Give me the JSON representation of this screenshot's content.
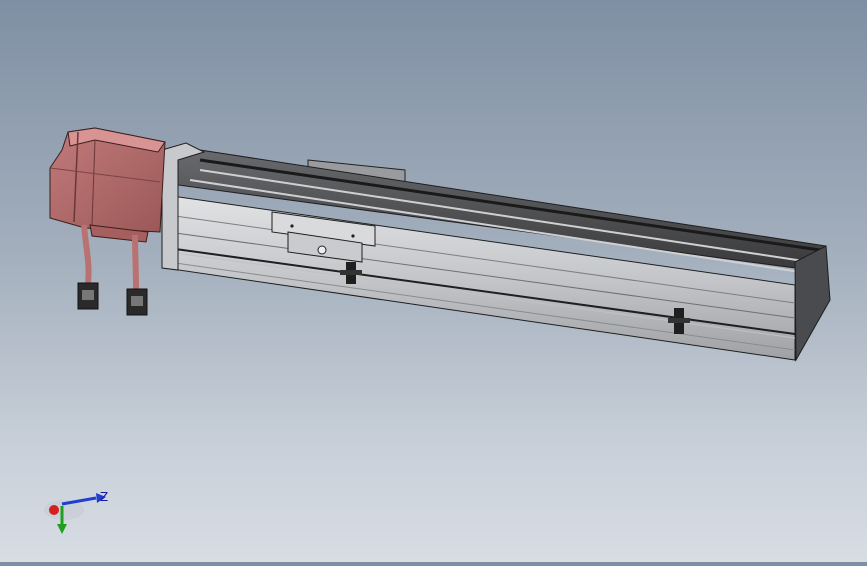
{
  "viewport": {
    "model": "linear-actuator-with-servo-motor",
    "colors": {
      "motor": "#b86a6a",
      "motor_dark": "#8e4a4a",
      "rail_light": "#d2d3d5",
      "rail_mid": "#a9abae",
      "rail_dark": "#3c3c3e",
      "edge": "#1e1e1e"
    }
  },
  "triad": {
    "z_label": "Z",
    "x_color": "#d42020",
    "y_color": "#20a020",
    "z_color": "#1f3fd0"
  }
}
